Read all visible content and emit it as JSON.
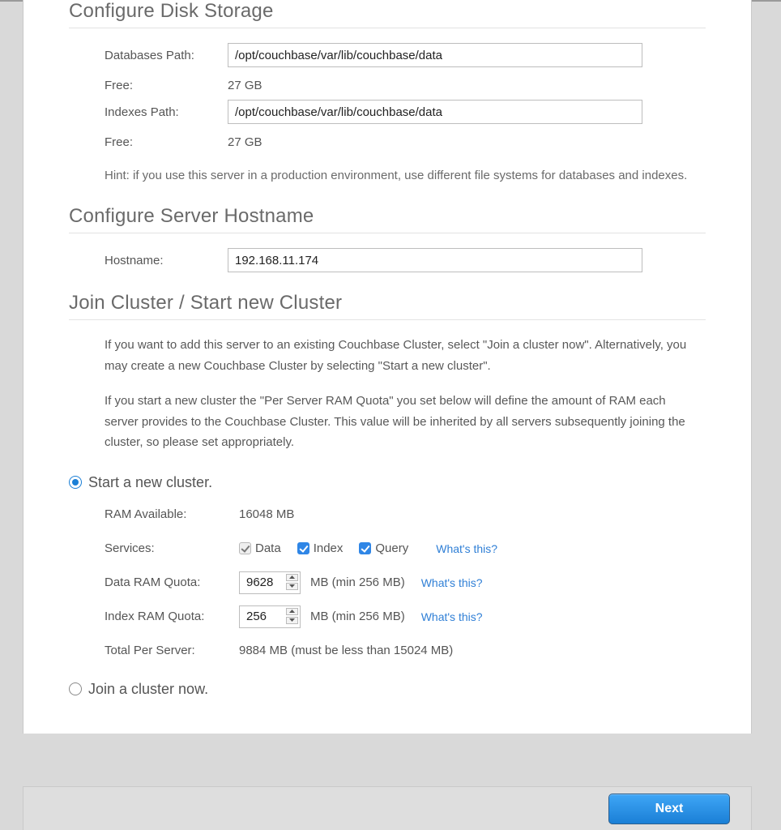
{
  "section1": {
    "title": "Configure Disk Storage",
    "db_path_label": "Databases Path:",
    "db_path_value": "/opt/couchbase/var/lib/couchbase/data",
    "db_free_label": "Free:",
    "db_free_value": "27 GB",
    "idx_path_label": "Indexes Path:",
    "idx_path_value": "/opt/couchbase/var/lib/couchbase/data",
    "idx_free_label": "Free:",
    "idx_free_value": "27 GB",
    "hint": "Hint: if you use this server in a production environment, use different file systems for databases and indexes."
  },
  "section2": {
    "title": "Configure Server Hostname",
    "hostname_label": "Hostname:",
    "hostname_value": "192.168.11.174"
  },
  "section3": {
    "title": "Join Cluster / Start new Cluster",
    "para1": "If you want to add this server to an existing Couchbase Cluster, select \"Join a cluster now\". Alternatively, you may create a new Couchbase Cluster by selecting \"Start a new cluster\".",
    "para2": "If you start a new cluster the \"Per Server RAM Quota\" you set below will define the amount of RAM each server provides to the Couchbase Cluster. This value will be inherited by all servers subsequently joining the cluster, so please set appropriately."
  },
  "cluster": {
    "start_label": "Start a new cluster.",
    "join_label": "Join a cluster now.",
    "ram_avail_label": "RAM Available:",
    "ram_avail_value": "16048 MB",
    "services_label": "Services:",
    "svc_data": "Data",
    "svc_index": "Index",
    "svc_query": "Query",
    "whats_this": "What's this?",
    "data_quota_label": "Data RAM Quota:",
    "data_quota_value": "9628",
    "quota_unit": "MB (min 256 MB)",
    "index_quota_label": "Index RAM Quota:",
    "index_quota_value": "256",
    "total_label": "Total Per Server:",
    "total_value": "9884 MB (must be less than 15024 MB)"
  },
  "footer": {
    "next": "Next"
  }
}
